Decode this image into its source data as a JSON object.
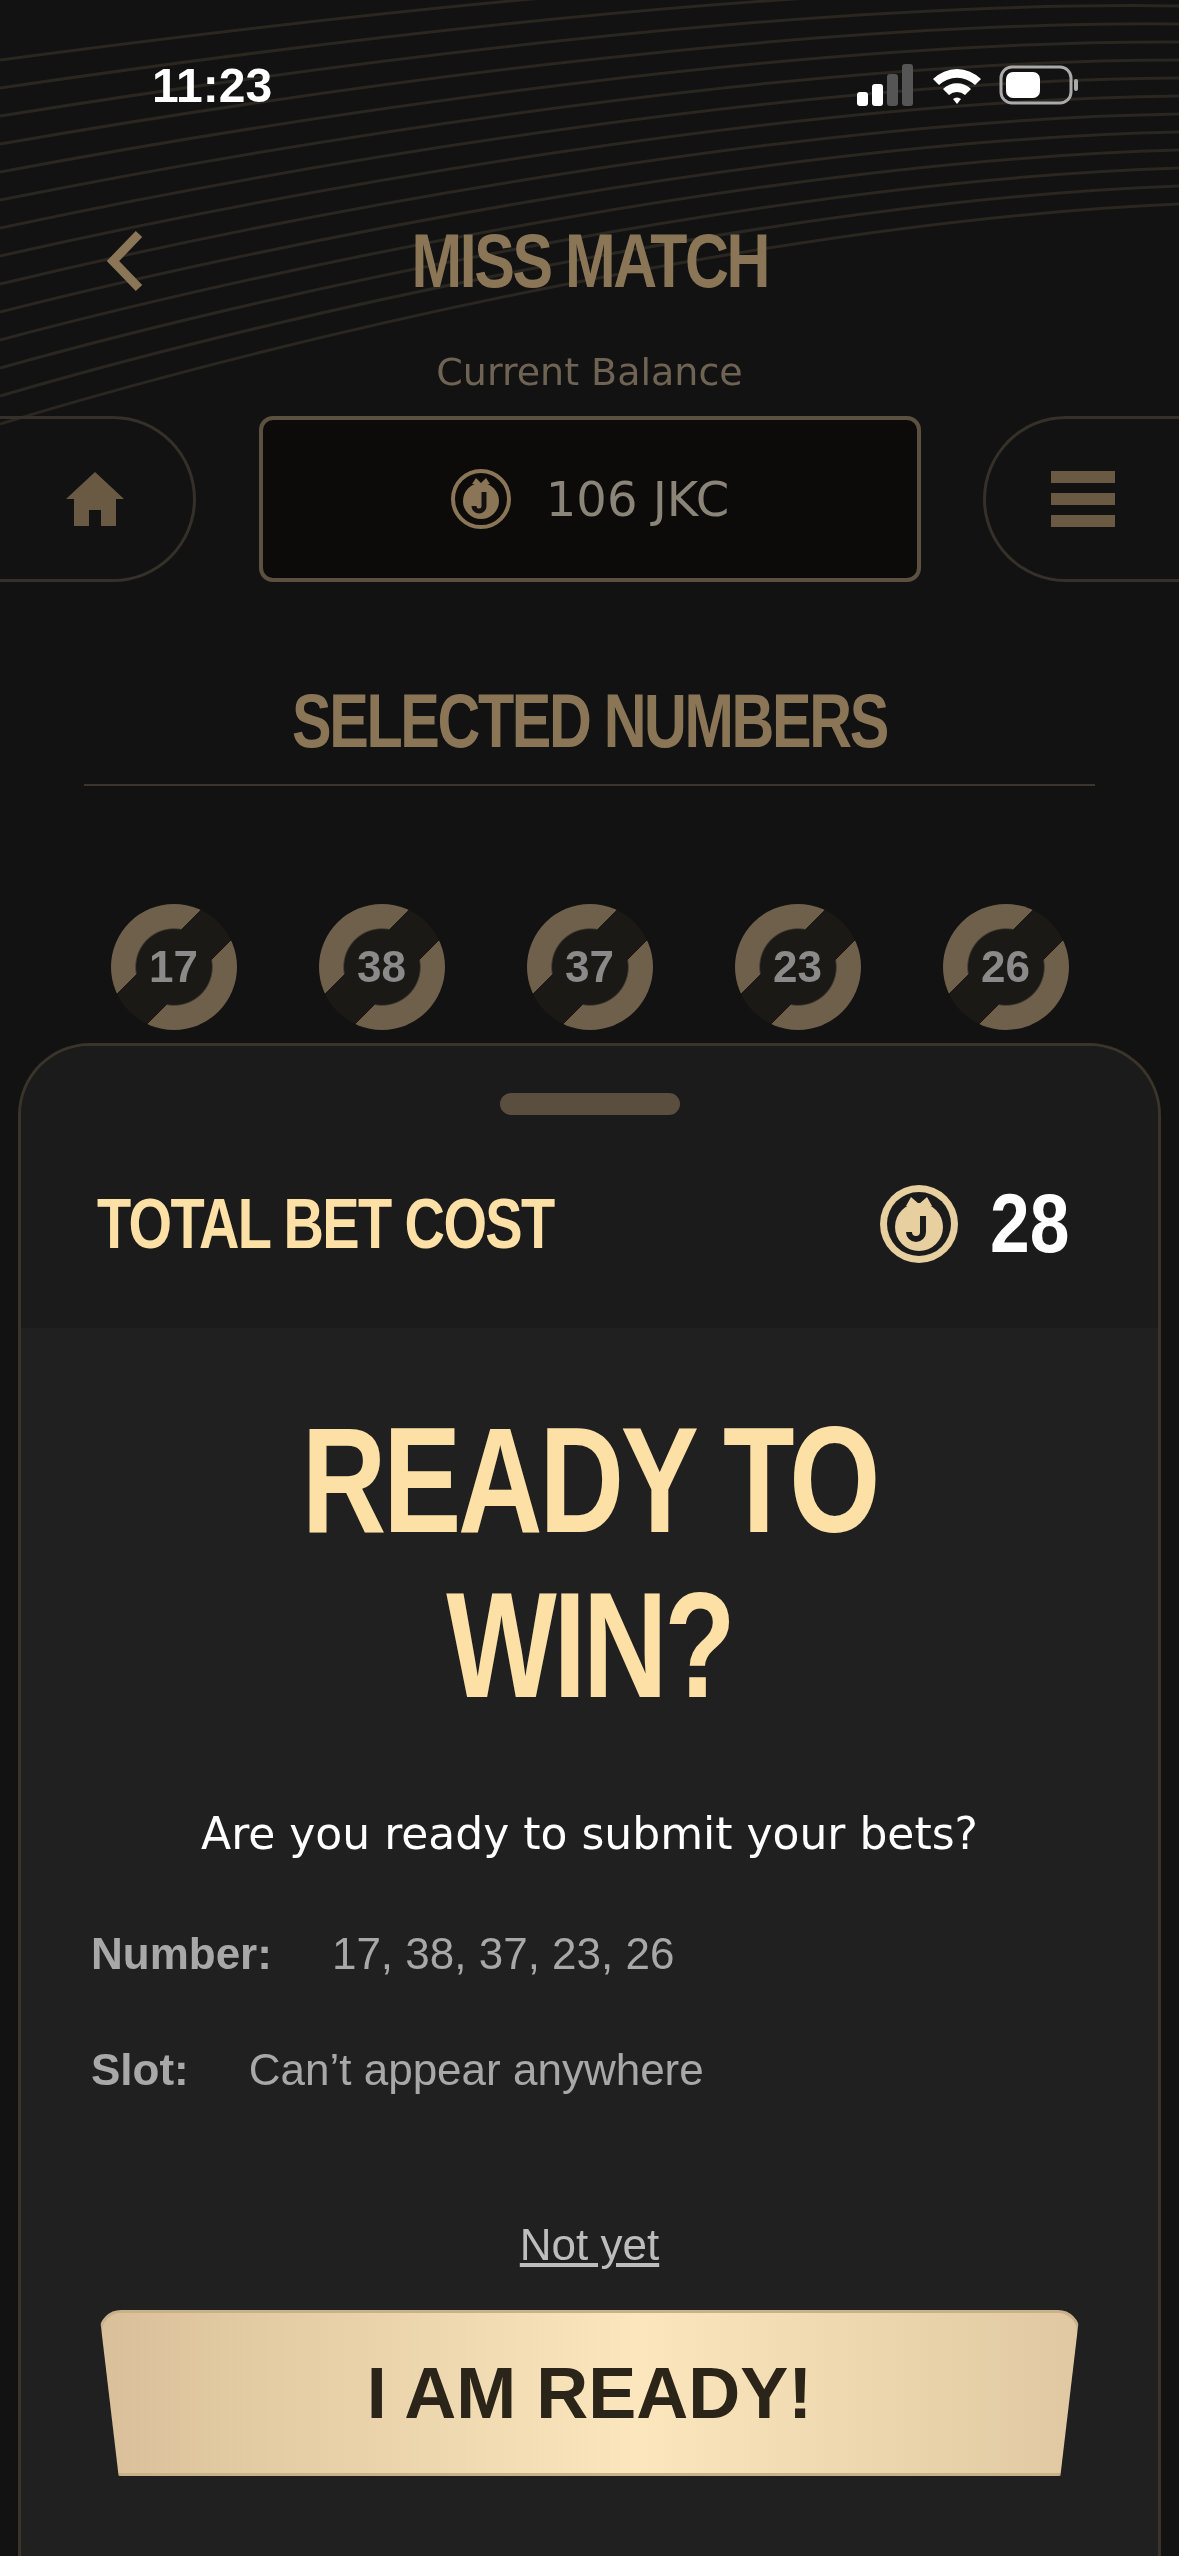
{
  "status_bar": {
    "time": "11:23"
  },
  "header": {
    "title": "MISS MATCH"
  },
  "balance": {
    "label": "Current Balance",
    "value": "106 JKC"
  },
  "selected_numbers": {
    "title": "SELECTED NUMBERS",
    "balls": [
      "17",
      "38",
      "37",
      "23",
      "26"
    ]
  },
  "sheet": {
    "cost_label": "TOTAL BET COST",
    "cost_value": "28",
    "title": "READY TO WIN?",
    "question": "Are you ready to submit your bets?",
    "details": [
      {
        "label": "Number:",
        "value": "17, 38, 37, 23, 26"
      },
      {
        "label": "Slot:",
        "value": "Can’t appear anywhere"
      }
    ],
    "cancel": "Not yet",
    "confirm": "I AM READY!"
  }
}
